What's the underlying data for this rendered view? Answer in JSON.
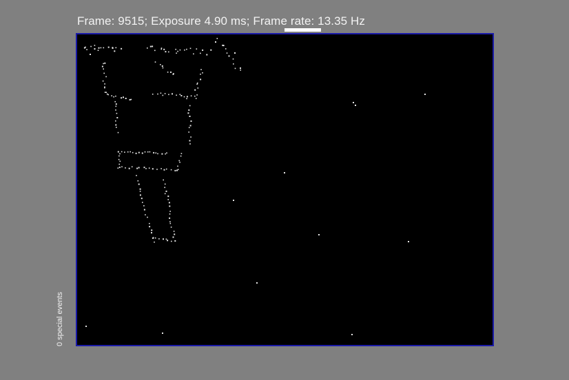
{
  "status": {
    "text": "Frame: 9515; Exposure 4.90 ms; Frame rate: 13.35 Hz"
  },
  "side_label": {
    "text": "0 special events"
  },
  "colors": {
    "background": "#808080",
    "frame_border": "#1a1aa8",
    "frame_fill": "#000000",
    "event_pixel": "#e6e6e6",
    "text": "#f2f2f2"
  }
}
